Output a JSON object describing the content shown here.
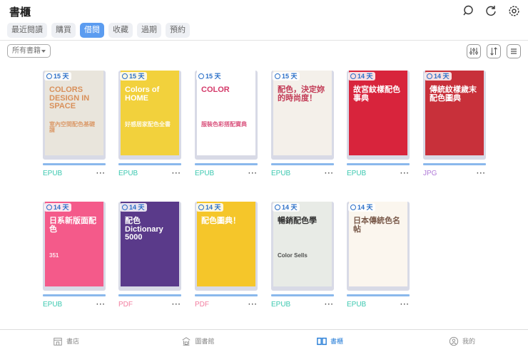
{
  "header": {
    "title": "書櫃",
    "icons": [
      "search-icon",
      "refresh-icon",
      "gear-icon"
    ]
  },
  "tabs": [
    {
      "label": "最近閱讀"
    },
    {
      "label": "購買"
    },
    {
      "label": "借閱",
      "active": true
    },
    {
      "label": "收藏"
    },
    {
      "label": "過期"
    },
    {
      "label": "預約"
    }
  ],
  "filter": {
    "selected": "所有書籍"
  },
  "tools": [
    "filter-sliders-icon",
    "sort-icon",
    "list-view-icon"
  ],
  "books": [
    {
      "days": "15 天",
      "format": "EPUB",
      "cover_title": "COLORS DESIGN IN SPACE",
      "cover_sub": "室內空間配色基礎課",
      "bg": "#e9e5dc",
      "fg": "#d9905a"
    },
    {
      "days": "15 天",
      "format": "EPUB",
      "cover_title": "Colors of HOME",
      "cover_sub": "好感居家配色全書",
      "bg": "#f2d13c",
      "fg": "#ffffff"
    },
    {
      "days": "15 天",
      "format": "EPUB",
      "cover_title": "COLOR",
      "cover_sub": "服裝色彩搭配寶典",
      "bg": "#ffffff",
      "fg": "#d43a6a"
    },
    {
      "days": "15 天",
      "format": "EPUB",
      "cover_title": "配色，決定妳的時尚度！",
      "cover_sub": "",
      "bg": "#f4f0ea",
      "fg": "#c23a55"
    },
    {
      "days": "14 天",
      "format": "EPUB",
      "cover_title": "故宮紋樣配色事典",
      "cover_sub": "",
      "bg": "#d8243c",
      "fg": "#ffffff"
    },
    {
      "days": "14 天",
      "format": "JPG",
      "cover_title": "傳統紋樣歲末配色圖典",
      "cover_sub": "",
      "bg": "#c8303a",
      "fg": "#ffffff"
    },
    {
      "days": "14 天",
      "format": "EPUB",
      "cover_title": "日系新版面配色",
      "cover_sub": "351",
      "bg": "#f45a8a",
      "fg": "#ffffff"
    },
    {
      "days": "14 天",
      "format": "PDF",
      "cover_title": "配色 Dictionary 5000",
      "cover_sub": "",
      "bg": "#5a3a8a",
      "fg": "#ffffff"
    },
    {
      "days": "14 天",
      "format": "PDF",
      "cover_title": "配色圖典！",
      "cover_sub": "",
      "bg": "#f5c62a",
      "fg": "#ffffff"
    },
    {
      "days": "14 天",
      "format": "EPUB",
      "cover_title": "暢銷配色學",
      "cover_sub": "Color Sells",
      "bg": "#e8ebe6",
      "fg": "#333333"
    },
    {
      "days": "14 天",
      "format": "EPUB",
      "cover_title": "日本傳統色名帖",
      "cover_sub": "",
      "bg": "#fbf6ee",
      "fg": "#7a5a4a"
    }
  ],
  "format_colors": {
    "EPUB": "#3cc8b0",
    "PDF": "#f27ea0",
    "JPG": "#b07ad8"
  },
  "bottom_nav": [
    {
      "label": "書店",
      "icon": "store-icon"
    },
    {
      "label": "圖書館",
      "icon": "library-icon"
    },
    {
      "label": "書櫃",
      "icon": "book-open-icon",
      "active": true
    },
    {
      "label": "我的",
      "icon": "user-icon"
    }
  ]
}
